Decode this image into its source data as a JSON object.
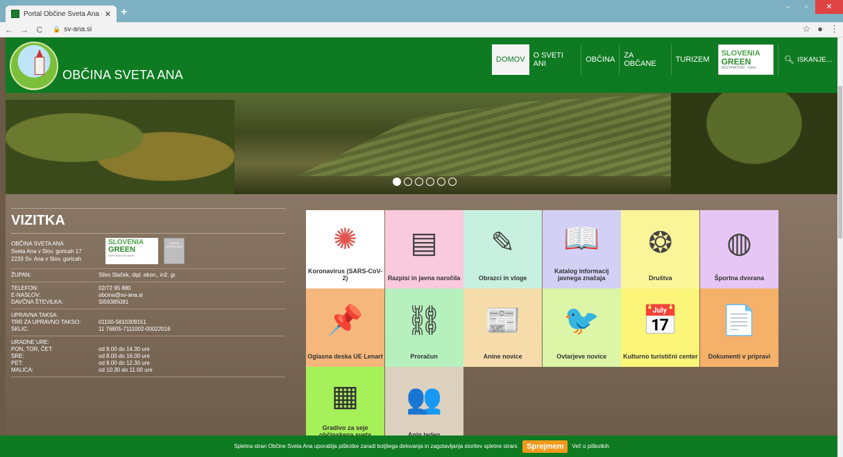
{
  "browser": {
    "tab_title": "Portal Občine Sveta Ana - Domo",
    "tab_close": "✕",
    "new_tab": "+",
    "url": "sv-ana.si",
    "minimize": "–",
    "maximize": "▫",
    "close": "✕",
    "star": "☆",
    "profile": "●",
    "kebab": "⋮"
  },
  "header": {
    "site_title": "OBČINA SVETA ANA",
    "menu": [
      "DOMOV",
      "O SVETI ANI",
      "OBČINA",
      "ZA OBČANE",
      "TURIZEM"
    ],
    "badge": {
      "l1": "SLOVENIA",
      "l2": "GREEN",
      "l3": "DESTINATION · Silver"
    },
    "search": "ISKANJE..."
  },
  "slider": {
    "dots": 6,
    "active": 0
  },
  "vizitka": {
    "title": "VIZITKA",
    "address": [
      "OBČINA SVETA ANA",
      "Sveta Ana v Slov. goricah 17",
      "2233 Sv. Ana v Slov. goricah"
    ],
    "badge": {
      "l1": "SLOVENIA",
      "l2": "GREEN",
      "l3": "DESTINATION Silver"
    },
    "cert": "GREEN CERTIFICATE",
    "zupan": {
      "k": "ŽUPAN:",
      "v": "Silvo Slaček, dipl. ekon., inž. gr."
    },
    "contacts": [
      {
        "k": "TELEFON:",
        "v": "02/72 95 880"
      },
      {
        "k": "E-NASLOV:",
        "v": "obcina@sv-ana.si"
      },
      {
        "k": "DAVČNA ŠTEVILKA:",
        "v": "SI59385081"
      }
    ],
    "taksa": [
      {
        "k": "UPRAVNA TAKSA:",
        "v": ""
      },
      {
        "k": "TRR ZA UPRAVNO TAKSO:",
        "v": "01100-5810309151"
      },
      {
        "k": "SKLIC:",
        "v": "11 76805-7111002-00022016"
      }
    ],
    "ure": [
      {
        "k": "URADNE URE:",
        "v": ""
      },
      {
        "k": "PON, TOR, ČET:",
        "v": "od 8.00 do 14.30 ure"
      },
      {
        "k": "SRE:",
        "v": "od 8.00 do 16.00 ure"
      },
      {
        "k": "PET:",
        "v": "od 8.00 do 12.30 ure"
      },
      {
        "k": "MALICA:",
        "v": "od 10.30 do 11.00 ure"
      }
    ]
  },
  "tiles": [
    {
      "label": "Koronavirus (SARS-CoV-2)",
      "bg": "#ffffff",
      "icon": "virus-icon",
      "glyph": "✺",
      "color": "#e0554f"
    },
    {
      "label": "Razpisi in javna naročila",
      "bg": "#f9c9dc",
      "icon": "documents-icon",
      "glyph": "▤",
      "color": "#444"
    },
    {
      "label": "Obrazci in vloge",
      "bg": "#c8f0e0",
      "icon": "form-icon",
      "glyph": "✎",
      "color": "#444"
    },
    {
      "label": "Katalog informacij javnega značaja",
      "bg": "#d3d0f5",
      "icon": "book-icon",
      "glyph": "📖",
      "color": "#444"
    },
    {
      "label": "Društva",
      "bg": "#fbf59a",
      "icon": "people-circle-icon",
      "glyph": "❂",
      "color": "#444"
    },
    {
      "label": "Športna dvorana",
      "bg": "#e6c7f4",
      "icon": "basketball-icon",
      "glyph": "◍",
      "color": "#444"
    },
    {
      "label": "Oglasna deska UE Lenart",
      "bg": "#f6b77c",
      "icon": "pushpin-icon",
      "glyph": "📌",
      "color": "#333"
    },
    {
      "label": "Proračun",
      "bg": "#b6f0bc",
      "icon": "chain-icon",
      "glyph": "⛓",
      "color": "#333"
    },
    {
      "label": "Anine novice",
      "bg": "#f5dcaa",
      "icon": "newspaper-icon",
      "glyph": "📰",
      "color": "#333"
    },
    {
      "label": "Ovtarjeve novice",
      "bg": "#dcf5a6",
      "icon": "bird-branch-icon",
      "glyph": "🐦",
      "color": "#555"
    },
    {
      "label": "Kulturno turistični center",
      "bg": "#fbf57a",
      "icon": "calendar-icon",
      "glyph": "📅",
      "color": "#333"
    },
    {
      "label": "Dokumenti v pripravi",
      "bg": "#f5b06a",
      "icon": "document-upload-icon",
      "glyph": "📄",
      "color": "#333"
    },
    {
      "label": "Gradivo za seje občinskega sveta",
      "bg": "#a6f05a",
      "icon": "document-list-icon",
      "glyph": "▦",
      "color": "#333"
    },
    {
      "label": "Anin teden",
      "bg": "#dcd0bf",
      "icon": "group-icon",
      "glyph": "👥",
      "color": "#333"
    }
  ],
  "cookie": {
    "text": "Spletna stran Občine Sveta Ana uporablja piškotke zaradi boljšega delovanja in zagotavljanja storitev spletne strani.",
    "accept": "Sprejmem",
    "more": "Več o piškotkih"
  }
}
